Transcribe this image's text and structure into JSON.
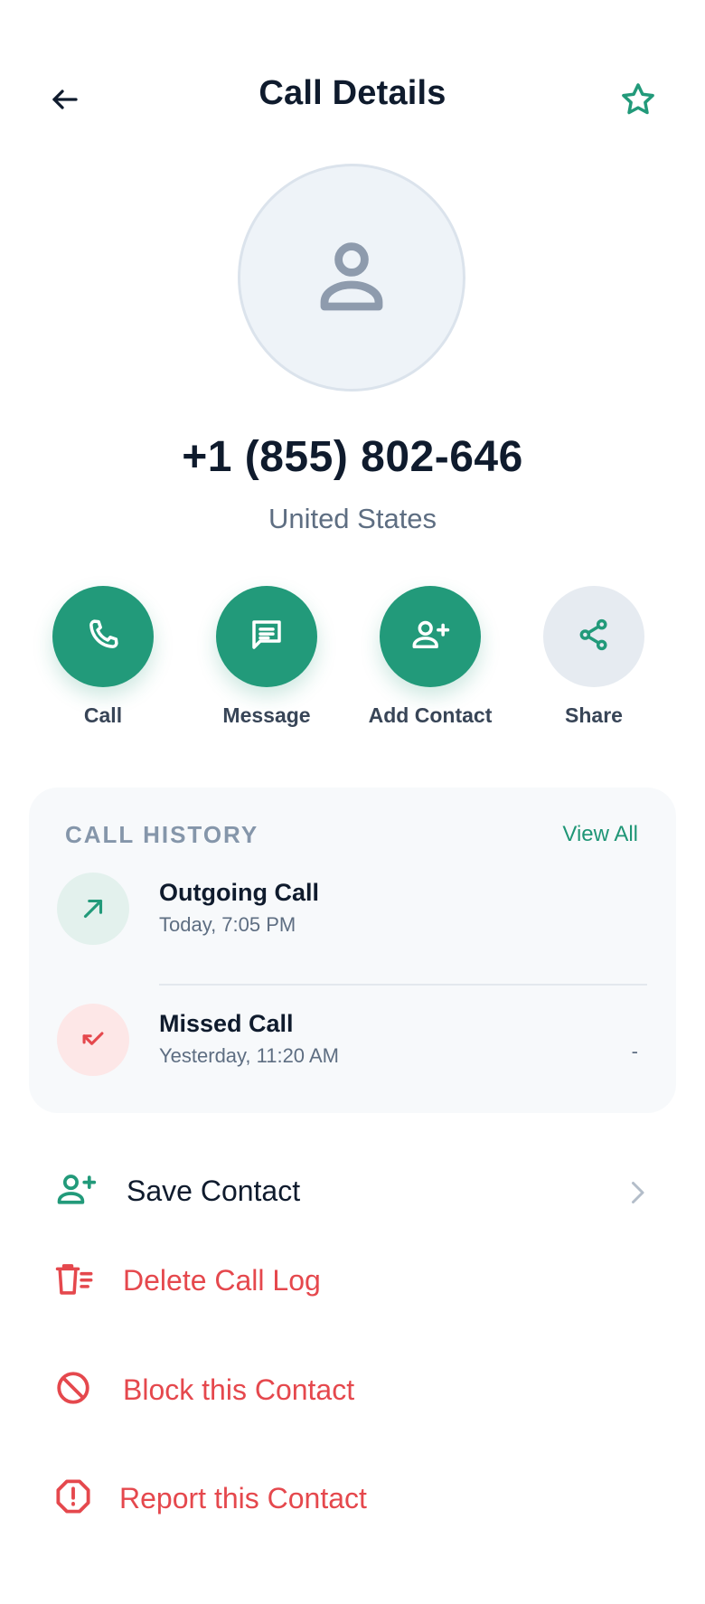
{
  "header": {
    "title": "Call Details",
    "back_icon": "arrow-left-icon",
    "favorite_icon": "star-outline-icon"
  },
  "contact": {
    "number": "+1 (855) 802-646",
    "country": "United States",
    "avatar_icon": "person-icon"
  },
  "actions": [
    {
      "label": "Call",
      "icon": "phone-icon",
      "color": "#229a7a"
    },
    {
      "label": "Message",
      "icon": "message-icon",
      "color": "#229a7a"
    },
    {
      "label": "Add Contact",
      "icon": "add-person-icon",
      "color": "#229a7a"
    },
    {
      "label": "Share",
      "icon": "share-icon",
      "color": "#e6ebf1"
    }
  ],
  "history": {
    "title": "CALL HISTORY",
    "view_all": "View All",
    "items": [
      {
        "title": "Outgoing Call",
        "time": "Today, 7:05 PM",
        "duration": "",
        "icon": "outgoing-arrow-icon"
      },
      {
        "title": "Missed Call",
        "time": "Yesterday, 11:20 AM",
        "duration": "-",
        "icon": "missed-call-icon"
      }
    ]
  },
  "options": {
    "save_contact": "Save Contact",
    "delete_log": "Delete Call Log",
    "block": "Block this Contact",
    "report": "Report this Contact"
  },
  "colors": {
    "accent": "#229a7a",
    "danger": "#e5484d",
    "text": "#0f1b2d",
    "muted": "#5e6e82"
  }
}
